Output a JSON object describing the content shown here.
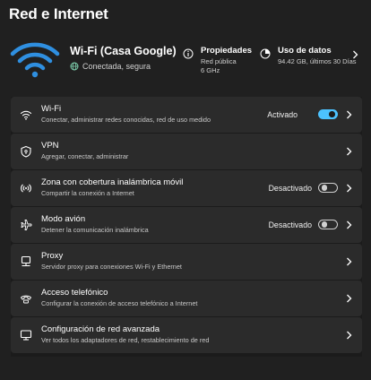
{
  "page": {
    "title": "Red e Internet"
  },
  "colors": {
    "accent": "#4cc2ff",
    "background": "#202020",
    "card": "#2b2b2b"
  },
  "hero": {
    "network_name": "Wi-Fi (Casa Google)",
    "status": "Conectada, segura",
    "properties": {
      "label": "Propiedades",
      "line1": "Red pública",
      "line2": "6 GHz"
    },
    "data_usage": {
      "label": "Uso de datos",
      "value": "94.42 GB, últimos 30 Días"
    }
  },
  "settings": [
    {
      "label": "Wi-Fi",
      "description": "Conectar, administrar redes conocidas, red de uso medido",
      "state": "Activado",
      "toggle": true,
      "icon": "wifi-icon"
    },
    {
      "label": "VPN",
      "description": "Agregar, conectar, administrar",
      "icon": "shield-icon"
    },
    {
      "label": "Zona con cobertura inalámbrica móvil",
      "description": "Compartir la conexión a Internet",
      "state": "Desactivado",
      "toggle": false,
      "icon": "hotspot-icon"
    },
    {
      "label": "Modo avión",
      "description": "Detener la comunicación inalámbrica",
      "state": "Desactivado",
      "toggle": false,
      "icon": "airplane-icon"
    },
    {
      "label": "Proxy",
      "description": "Servidor proxy para conexiones Wi-Fi y Ethernet",
      "icon": "globe-icon"
    },
    {
      "label": "Acceso telefónico",
      "description": "Configurar la conexión de acceso telefónico a Internet",
      "icon": "phone-icon"
    },
    {
      "label": "Configuración de red avanzada",
      "description": "Ver todos los adaptadores de red, restablecimiento de red",
      "icon": "monitor-icon"
    }
  ]
}
